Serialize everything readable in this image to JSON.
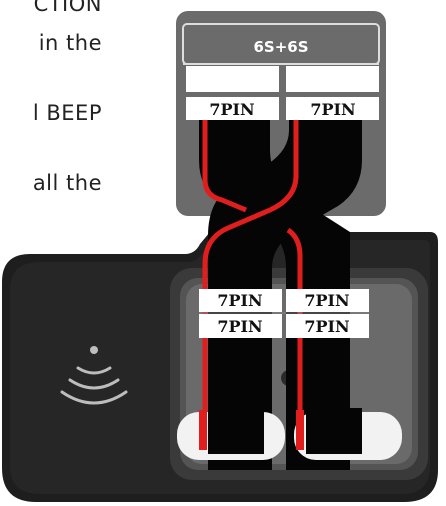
{
  "text_lines": [
    "CTION",
    "in the",
    "l BEEP",
    "all the"
  ],
  "board": {
    "title": "6S+6S",
    "top_pins": [
      "7PIN",
      "7PIN"
    ],
    "bottom_pins_row1": [
      "7PIN",
      "7PIN"
    ],
    "bottom_pins_row2": [
      "7PIN",
      "7PIN"
    ]
  },
  "icons": [
    "wireless-signal-icon"
  ],
  "colors": {
    "board_gray": "#6b6b6b",
    "device_body": "#1f1f1f",
    "cable_black": "#050505",
    "wire_red": "#e01e1e"
  }
}
